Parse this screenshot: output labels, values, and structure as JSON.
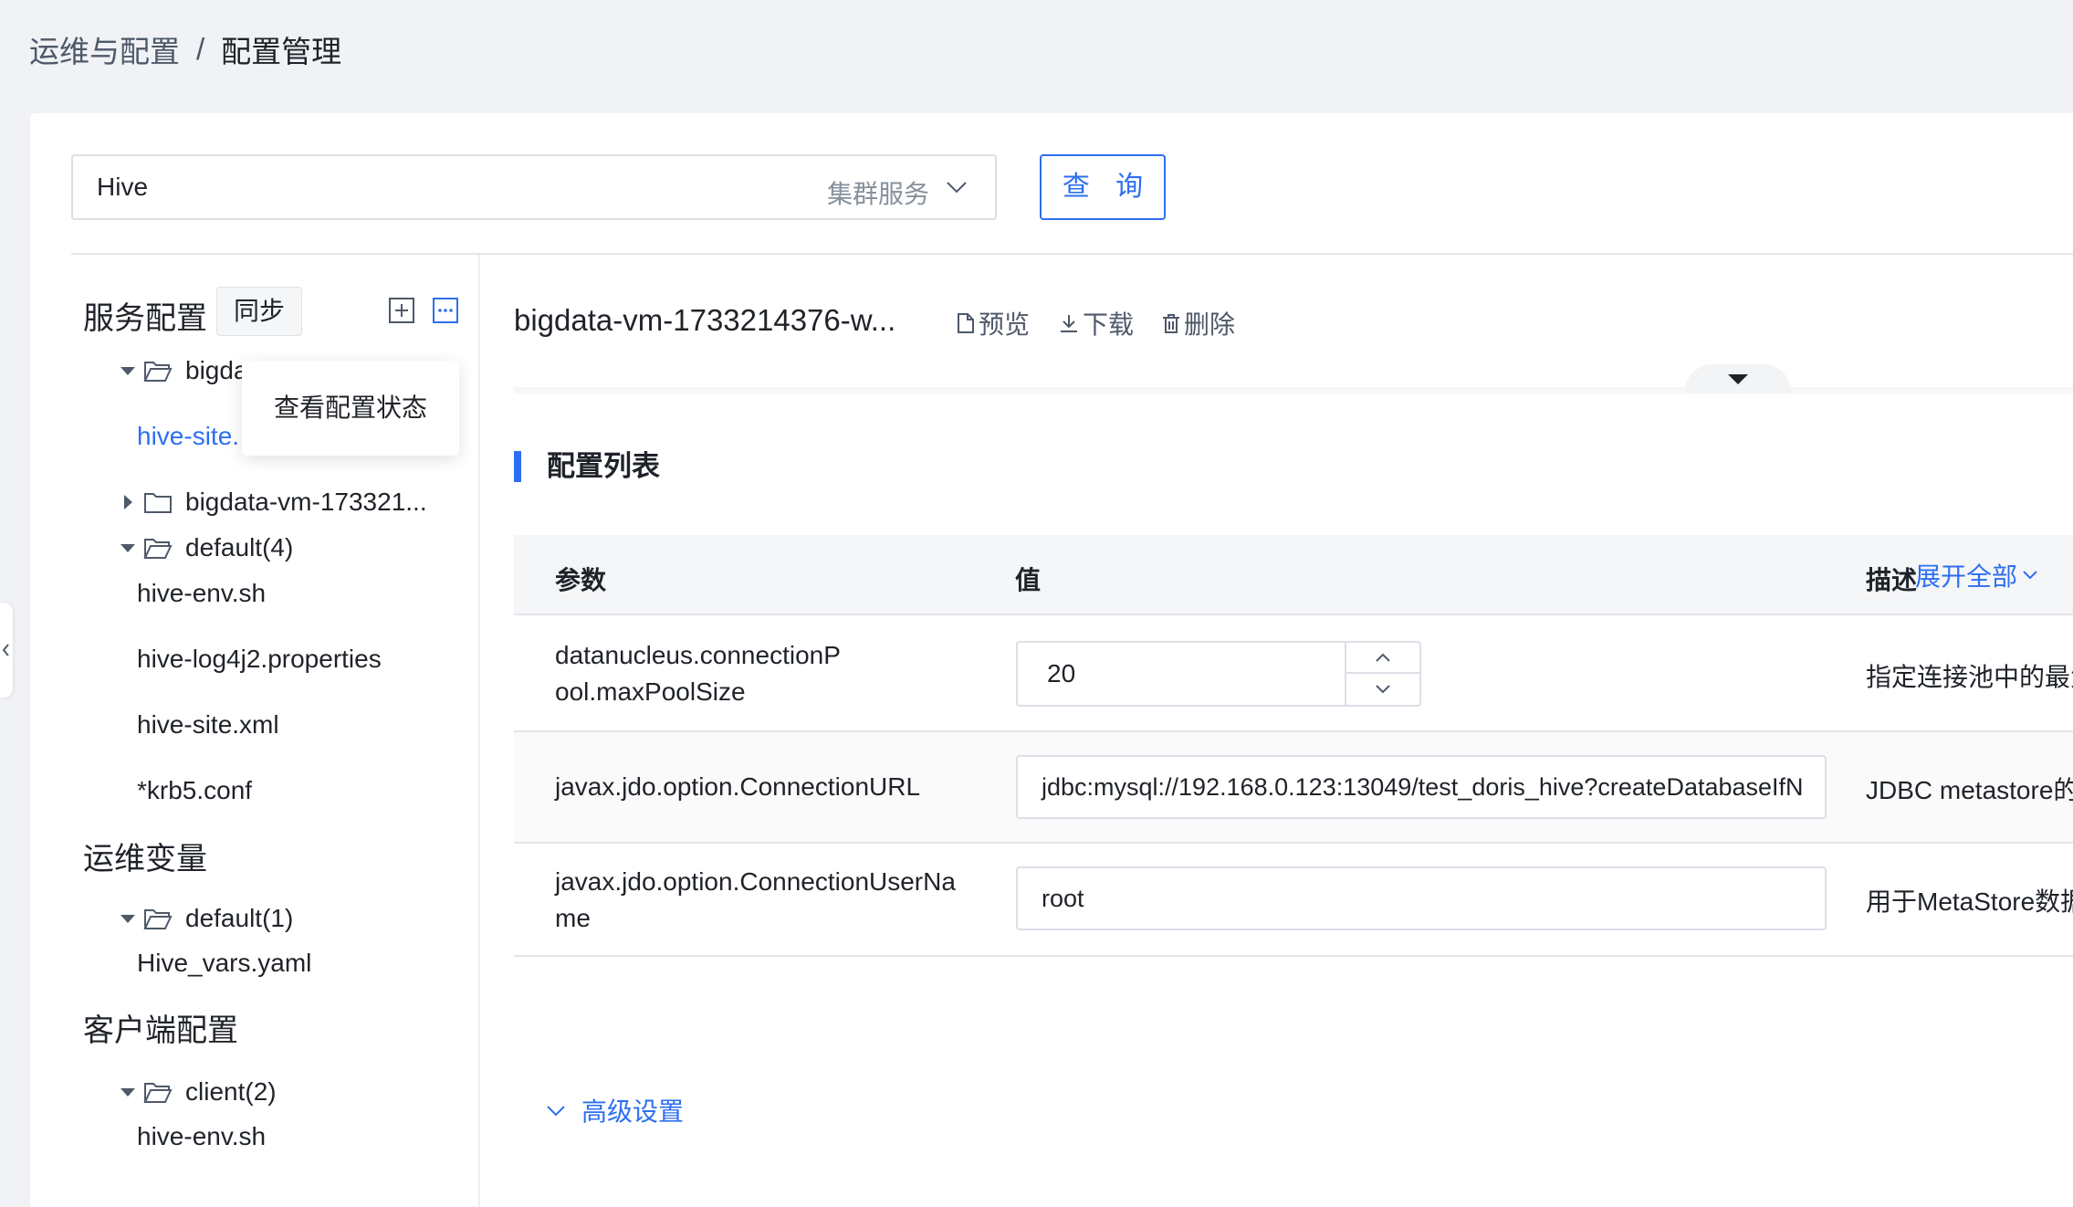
{
  "breadcrumb": {
    "parent": "运维与配置",
    "separator": "/",
    "current": "配置管理"
  },
  "search": {
    "value": "Hive",
    "hint": "集群服务",
    "query_label": "查 询"
  },
  "left": {
    "service_config_title": "服务配置",
    "sync_label": "同步",
    "popover_text": "查看配置状态",
    "tree": [
      {
        "label": "bigdata",
        "type": "folder",
        "expanded": true
      },
      {
        "label": "hive-site.",
        "type": "file",
        "active": true
      },
      {
        "label": "bigdata-vm-173321...",
        "type": "folder",
        "expanded": false
      },
      {
        "label": "default(4)",
        "type": "folder",
        "expanded": true
      },
      {
        "label": "hive-env.sh",
        "type": "file"
      },
      {
        "label": "hive-log4j2.properties",
        "type": "file"
      },
      {
        "label": "hive-site.xml",
        "type": "file"
      },
      {
        "label": "*krb5.conf",
        "type": "file"
      }
    ],
    "ops_vars_title": "运维变量",
    "ops_tree": [
      {
        "label": "default(1)",
        "type": "folder",
        "expanded": true
      },
      {
        "label": "Hive_vars.yaml",
        "type": "file"
      }
    ],
    "client_title": "客户端配置",
    "client_tree": [
      {
        "label": "client(2)",
        "type": "folder",
        "expanded": true
      },
      {
        "label": "hive-env.sh",
        "type": "file"
      }
    ]
  },
  "file": {
    "title": "bigdata-vm-1733214376-w...",
    "preview_label": "预览",
    "download_label": "下载",
    "delete_label": "删除"
  },
  "config_list": {
    "title": "配置列表",
    "columns": {
      "param": "参数",
      "value": "值",
      "desc": "描述"
    },
    "expand_all": "展开全部",
    "rows": [
      {
        "param": "datanucleus.connectionPool.maxPoolSize",
        "value": "20",
        "desc": "指定连接池中的最大连"
      },
      {
        "param": "javax.jdo.option.ConnectionURL",
        "value": "jdbc:mysql://192.168.0.123:13049/test_doris_hive?createDatabaseIfN",
        "desc": "JDBC metastore的JD"
      },
      {
        "param": "javax.jdo.option.ConnectionUserName",
        "value": "root",
        "desc": "用于MetaStore数据库"
      }
    ],
    "advanced_label": "高级设置"
  },
  "colors": {
    "primary": "#2d6ff0",
    "text": "#1f2329",
    "border": "#dcdfe6"
  }
}
